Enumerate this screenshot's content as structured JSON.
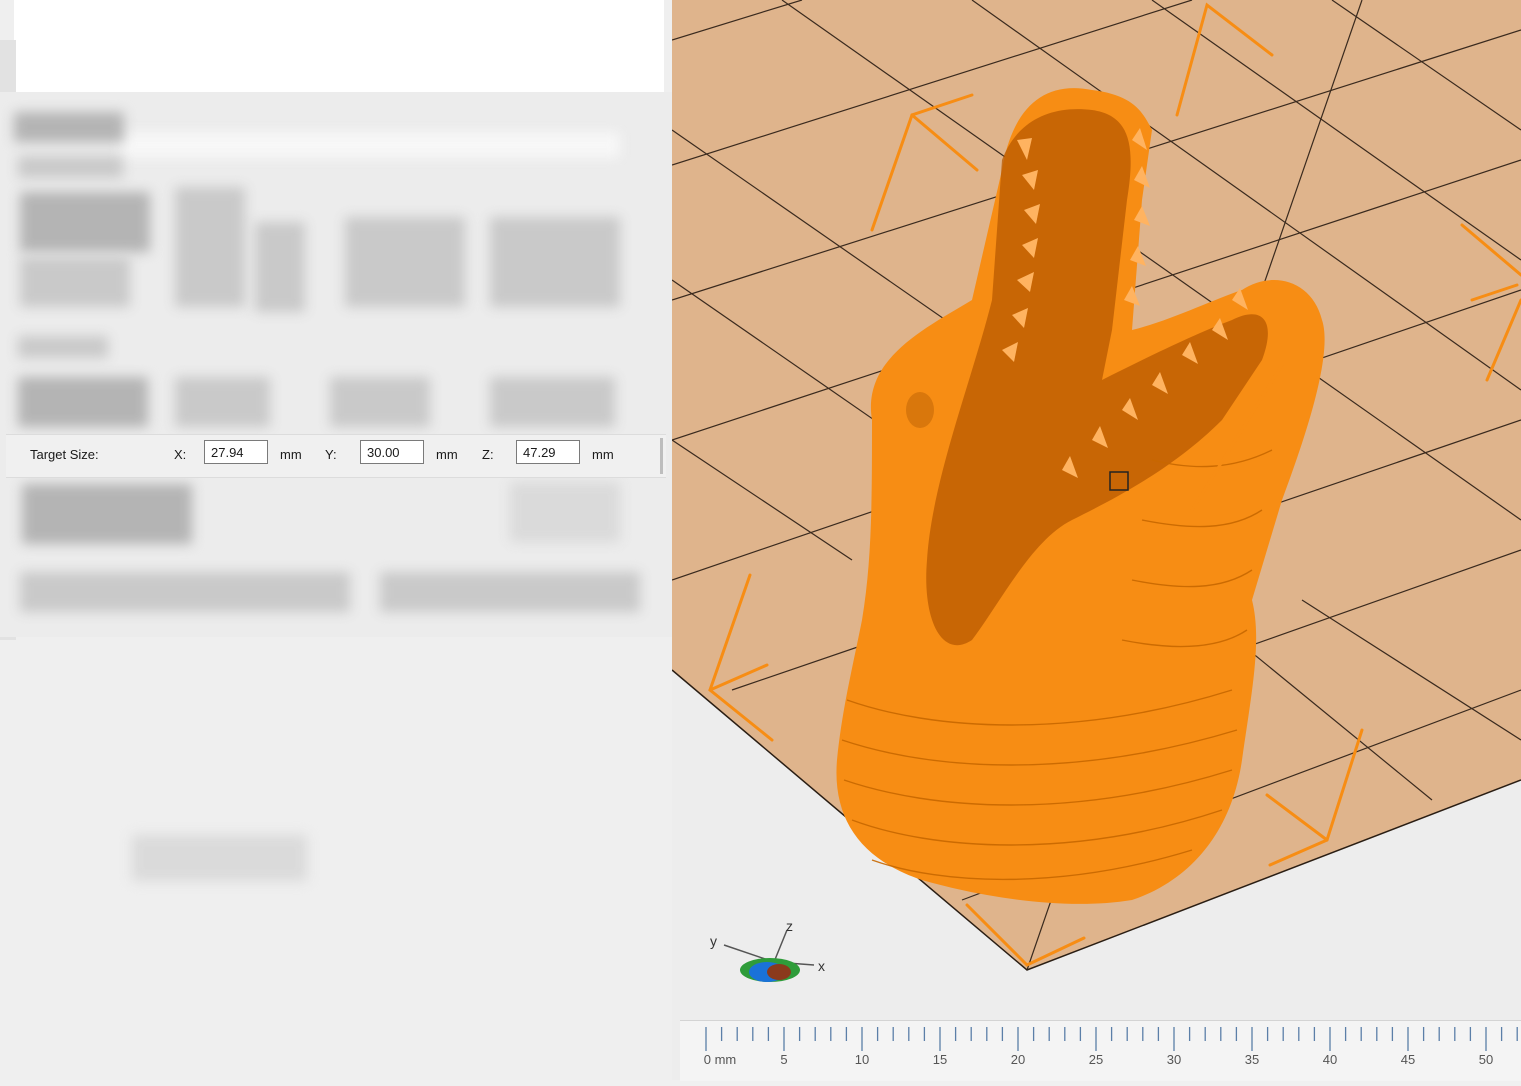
{
  "target_size": {
    "label": "Target Size:",
    "x_label": "X:",
    "y_label": "Y:",
    "z_label": "Z:",
    "x_value": "27.94",
    "y_value": "30.00",
    "z_value": "47.29",
    "unit": "mm"
  },
  "viewport": {
    "bed_color": "#dfb48c",
    "model_color": "#f78d14",
    "arrow_color": "#f78d14",
    "axis_gizmo": {
      "x": "x",
      "y": "y",
      "z": "z"
    }
  },
  "ruler": {
    "ticks": [
      "0 mm",
      "5",
      "10",
      "15",
      "20",
      "25",
      "30",
      "35",
      "40",
      "45",
      "50"
    ]
  }
}
